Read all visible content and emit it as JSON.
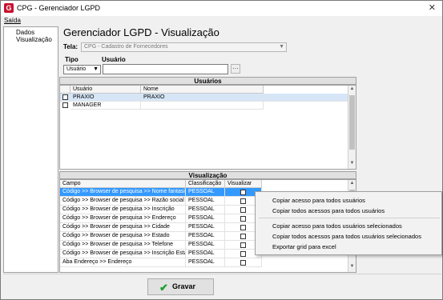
{
  "window": {
    "title": "CPG - Gerenciador LGPD",
    "app_icon": "G",
    "close_glyph": "✕"
  },
  "menu": {
    "saida": "Saída"
  },
  "sidebar": {
    "items": [
      {
        "label": "Dados"
      },
      {
        "label": "Visualização"
      }
    ]
  },
  "main": {
    "heading": "Gerenciador LGPD - Visualização",
    "tela_label": "Tela:",
    "tela_value": "CPG - Cadastro de Fornecedores",
    "tipo_label": "Tipo",
    "tipo_value": "Usuário",
    "usuario_label": "Usuário",
    "usuario_value": "",
    "search_glyph": "⋯"
  },
  "usuarios": {
    "section_title": "Usuários",
    "columns": [
      "Usuário",
      "Nome"
    ],
    "rows": [
      {
        "usuario": "PRAXIO",
        "nome": "PRAXIO",
        "checked": false,
        "selected": true
      },
      {
        "usuario": "MANAGER",
        "nome": "",
        "checked": false,
        "selected": false
      }
    ]
  },
  "visualizacao": {
    "section_title": "Visualização",
    "columns": [
      "Campo",
      "Classificação",
      "Visualizar"
    ],
    "rows": [
      {
        "campo": "Código >> Browser de pesquisa >> Nome fantasia",
        "classificacao": "PESSOAL",
        "selected": true
      },
      {
        "campo": "Código >> Browser de pesquisa >> Razão social",
        "classificacao": "PESSOAL"
      },
      {
        "campo": "Código >> Browser de pesquisa >> Inscrição",
        "classificacao": "PESSOAL"
      },
      {
        "campo": "Código >> Browser de pesquisa >> Endereço",
        "classificacao": "PESSOAL"
      },
      {
        "campo": "Código >> Browser de pesquisa >> Cidade",
        "classificacao": "PESSOAL"
      },
      {
        "campo": "Código >> Browser de pesquisa >> Estado",
        "classificacao": "PESSOAL"
      },
      {
        "campo": "Código >> Browser de pesquisa >> Telefone",
        "classificacao": "PESSOAL"
      },
      {
        "campo": "Código >> Browser de pesquisa >> Inscrição Esta...",
        "classificacao": "PESSOAL"
      },
      {
        "campo": "Aba Endereço >> Endereço",
        "classificacao": "PESSOAL"
      }
    ]
  },
  "footer": {
    "gravar_label": "Gravar"
  },
  "context_menu": {
    "items": [
      "Copiar acesso para todos usuários",
      "Copiar todos acessos para todos usuários",
      "Copiar acesso para todos usuários selecionados",
      "Copiar todos acessos para todos usuários selecionados",
      "Exportar grid para excel"
    ]
  },
  "colors": {
    "selection": "#3399ff",
    "row_highlight": "#d6e6f7",
    "ok_green": "#1e9e2f"
  }
}
